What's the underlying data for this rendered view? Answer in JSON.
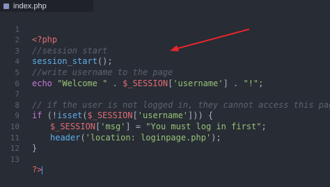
{
  "tab": {
    "filename": "index.php",
    "icon": "php-file-icon"
  },
  "line_numbers": [
    "1",
    "2",
    "3",
    "4",
    "5",
    "6",
    "7",
    "8",
    "9",
    "10",
    "11",
    "12",
    "13"
  ],
  "code": {
    "l1": [
      "<?php"
    ],
    "l2": [
      "//session start"
    ],
    "l3": [
      "session_start",
      "();"
    ],
    "l4": [
      "//write username to the page"
    ],
    "l5": [
      "echo ",
      "\"Welcome \"",
      " . ",
      "$_SESSION",
      "[",
      "'username'",
      "] . ",
      "\"!\"",
      ";"
    ],
    "l6": [
      ""
    ],
    "l7": [
      "// if the user is not logged in, they cannot access this page"
    ],
    "l8": [
      "if",
      " (!",
      "isset",
      "(",
      "$_SESSION",
      "[",
      "'username'",
      "])) {"
    ],
    "l9": [
      "$_SESSION",
      "[",
      "'msg'",
      "] = ",
      "\"You must log in first\"",
      ";"
    ],
    "l10": [
      "header",
      "(",
      "'location: loginpage.php'",
      ");"
    ],
    "l11": [
      "}"
    ],
    "l12": [
      ""
    ],
    "l13": [
      "?>"
    ]
  },
  "colors": {
    "background": "#282c34",
    "keyword": "#c678dd",
    "function": "#61afef",
    "string": "#98c379",
    "variable": "#e06c75",
    "comment": "#5c6370",
    "annotation_arrow": "#e5262e"
  }
}
